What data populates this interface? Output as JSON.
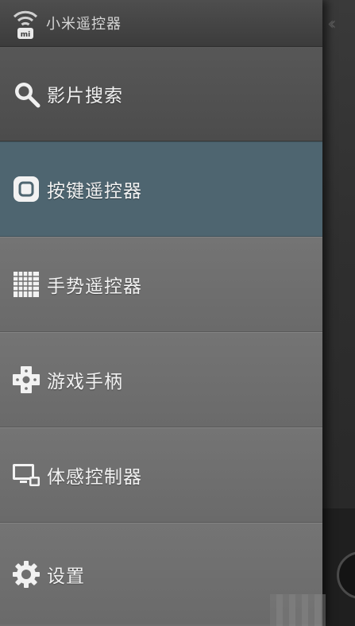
{
  "header": {
    "title": "小米遥控器",
    "logo_icon": "wifi-mi-icon"
  },
  "menu": {
    "items": [
      {
        "label": "影片搜索",
        "icon": "search-icon",
        "active": false
      },
      {
        "label": "按键遥控器",
        "icon": "button-remote-icon",
        "active": true
      },
      {
        "label": "手势遥控器",
        "icon": "grid-icon",
        "active": false
      },
      {
        "label": "游戏手柄",
        "icon": "dpad-icon",
        "active": false
      },
      {
        "label": "体感控制器",
        "icon": "monitor-icon",
        "active": false
      },
      {
        "label": "设置",
        "icon": "gear-icon",
        "active": false
      }
    ]
  },
  "underlying": {
    "back_icon": "double-chevron-left-icon"
  },
  "colors": {
    "drawer_bg": "#6f6f6f",
    "active_bg": "#4e6570",
    "header_bg": "#3c3c3c",
    "text": "#f2f2f2"
  }
}
